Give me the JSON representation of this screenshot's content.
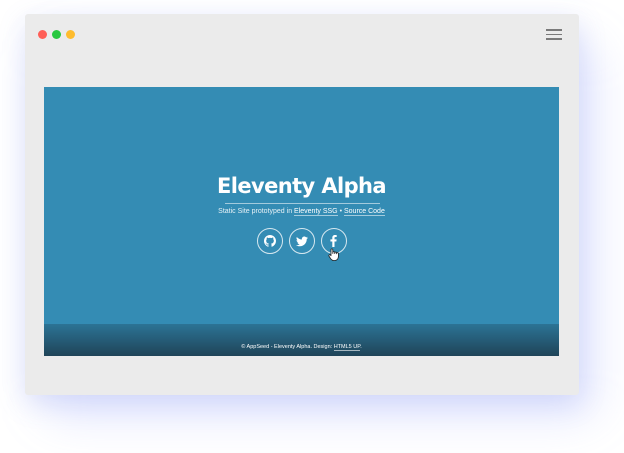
{
  "window": {
    "traffic_lights": [
      {
        "name": "close",
        "color": "#ff5f57"
      },
      {
        "name": "minimize",
        "color": "#28c840"
      },
      {
        "name": "maximize",
        "color": "#febc2e"
      }
    ],
    "menu_icon": "hamburger-menu-icon"
  },
  "hero": {
    "title": "Eleventy Alpha",
    "subtitle_text": "Static Site prototyped in",
    "subtitle_link1": "Eleventy SSG",
    "subtitle_separator": "•",
    "subtitle_link2": "Source Code",
    "background": "#348cb4",
    "socials": [
      {
        "name": "github",
        "icon": "github-icon"
      },
      {
        "name": "twitter",
        "icon": "twitter-icon"
      },
      {
        "name": "facebook",
        "icon": "facebook-icon"
      }
    ]
  },
  "footer": {
    "text": "© AppSeed - Eleventy Alpha. Design:",
    "link": "HTML5 UP",
    "end": "."
  }
}
